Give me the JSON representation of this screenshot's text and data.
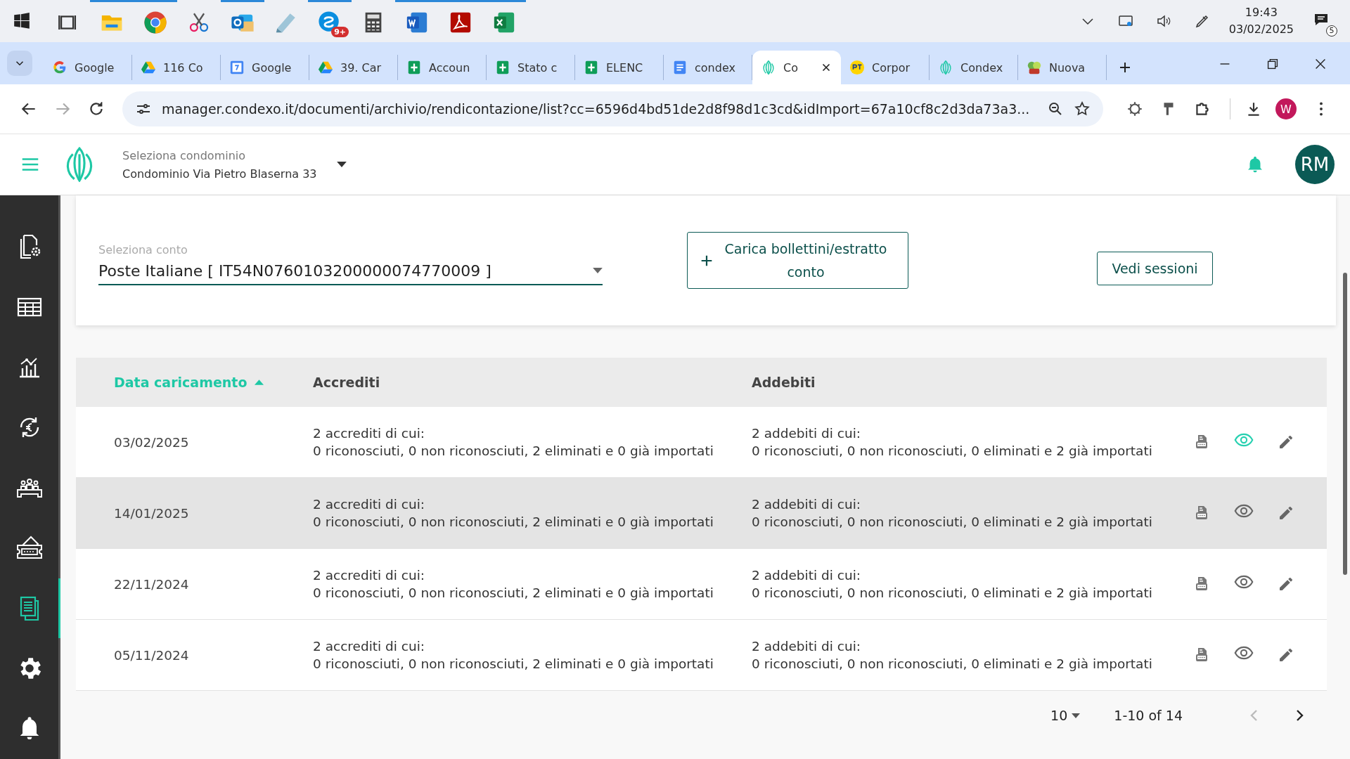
{
  "taskbar": {
    "apps": [
      {
        "kind": "taskview",
        "running": false
      },
      {
        "kind": "folder",
        "running": true
      },
      {
        "kind": "browser",
        "running": true
      },
      {
        "kind": "snip",
        "running": false
      },
      {
        "kind": "mail",
        "running": true
      },
      {
        "kind": "notes",
        "running": false
      },
      {
        "kind": "chat",
        "running": true,
        "badge": "9+"
      },
      {
        "kind": "calc",
        "running": false
      },
      {
        "kind": "word",
        "running": true
      },
      {
        "kind": "pdf",
        "running": true
      },
      {
        "kind": "excel",
        "running": true
      }
    ],
    "time": "19:43",
    "date": "03/02/2025",
    "notifications": "5"
  },
  "browser": {
    "tabs": [
      {
        "title": "Google",
        "kind": "g",
        "selected": false
      },
      {
        "title": "116 Co",
        "kind": "drive",
        "selected": false
      },
      {
        "title": "Google",
        "kind": "calendar",
        "selected": false
      },
      {
        "title": "39. Car",
        "kind": "drive",
        "selected": false
      },
      {
        "title": "Accoun",
        "kind": "sheet",
        "selected": false
      },
      {
        "title": "Stato c",
        "kind": "sheet",
        "selected": false
      },
      {
        "title": "ELENC",
        "kind": "sheet",
        "selected": false
      },
      {
        "title": "condex",
        "kind": "doc",
        "selected": false
      },
      {
        "title": "Co",
        "kind": "leaf",
        "selected": true
      },
      {
        "title": "Corpor",
        "kind": "pt",
        "selected": false
      },
      {
        "title": "Condex",
        "kind": "leaf",
        "selected": false
      },
      {
        "title": "Nuova",
        "kind": "game",
        "selected": false
      }
    ],
    "url": "manager.condexo.it/documenti/archivio/rendicontazione/list?cc=6596d4bd51de2d8f98d1c3cd&idImport=67a10cf8c2d3da73a3...",
    "profile": "W"
  },
  "header": {
    "label": "Seleziona condominio",
    "value": "Condominio Via Pietro Blaserna 33",
    "avatar": "RM"
  },
  "sidebar": {
    "items": [
      {
        "kind": "doc-gear",
        "selected": false
      },
      {
        "kind": "table",
        "selected": false
      },
      {
        "kind": "chart",
        "selected": false
      },
      {
        "kind": "cycle",
        "selected": false
      },
      {
        "kind": "meeting",
        "selected": false
      },
      {
        "kind": "ticket",
        "selected": false
      },
      {
        "kind": "docs",
        "selected": true
      },
      {
        "kind": "gear",
        "selected": false
      },
      {
        "kind": "bell",
        "selected": false
      }
    ]
  },
  "account": {
    "label": "Seleziona conto",
    "value": "Poste Italiane [ IT54N0760103200000074770009 ]"
  },
  "upload_button": "Carica bollettini/estratto conto",
  "sessions_button": "Vedi sessioni",
  "table": {
    "columns": [
      {
        "label": "Data caricamento",
        "sorted": true
      },
      {
        "label": "Accrediti",
        "sorted": false
      },
      {
        "label": "Addebiti",
        "sorted": false
      }
    ],
    "rows": [
      {
        "date": "03/02/2025",
        "credits": "2 accrediti di cui:",
        "credits_detail": "0 riconosciuti, 0 non riconosciuti, 2 eliminati e 0 già importati",
        "debits": "2 addebiti di cui:",
        "debits_detail": "0 riconosciuti, 0 non riconosciuti, 0 eliminati e 2 già importati",
        "viewed": true,
        "hovered": false
      },
      {
        "date": "14/01/2025",
        "credits": "2 accrediti di cui:",
        "credits_detail": "0 riconosciuti, 0 non riconosciuti, 2 eliminati e 0 già importati",
        "debits": "2 addebiti di cui:",
        "debits_detail": "0 riconosciuti, 0 non riconosciuti, 0 eliminati e 2 già importati",
        "viewed": false,
        "hovered": true
      },
      {
        "date": "22/11/2024",
        "credits": "2 accrediti di cui:",
        "credits_detail": "0 riconosciuti, 0 non riconosciuti, 2 eliminati e 0 già importati",
        "debits": "2 addebiti di cui:",
        "debits_detail": "0 riconosciuti, 0 non riconosciuti, 0 eliminati e 2 già importati",
        "viewed": false,
        "hovered": false
      },
      {
        "date": "05/11/2024",
        "credits": "2 accrediti di cui:",
        "credits_detail": "0 riconosciuti, 0 non riconosciuti, 2 eliminati e 0 già importati",
        "debits": "2 addebiti di cui:",
        "debits_detail": "0 riconosciuti, 0 non riconosciuti, 0 eliminati e 2 già importati",
        "viewed": false,
        "hovered": false
      }
    ]
  },
  "pagination": {
    "per_page": "10",
    "range": "1-10 of 14",
    "prev_disabled": true
  }
}
